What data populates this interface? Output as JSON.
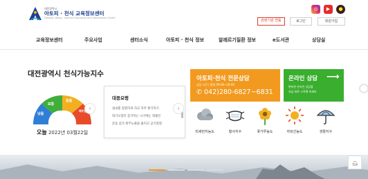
{
  "header": {
    "logo_small": "대전광역시",
    "logo_main": "아토피 · 천식 교육정보센터",
    "logo_eng": "Daejeon Atopy · Asthma Education and Information Center",
    "sns": [
      {
        "name": "instagram",
        "glyph": "◎"
      },
      {
        "name": "youtube",
        "glyph": "▶"
      },
      {
        "name": "kakao",
        "glyph": "●"
      }
    ],
    "manager_btn": "관련기관 연동",
    "login_btn": "로그인",
    "join_btn": "회원가입"
  },
  "nav": [
    "교육정보센터",
    "주요사업",
    "센터소식",
    "아토피 · 천식 정보",
    "알레르기질환 정보",
    "e도서관",
    "상담실"
  ],
  "index": {
    "title": "대전광역시 천식가능지수",
    "gauge_labels": [
      "낮음",
      "보통",
      "높음",
      "매우높음"
    ],
    "today_label": "오늘",
    "date": "2022년 03월22일"
  },
  "action": {
    "title": "대응요령",
    "lines": [
      "실내를 청결하게 하고 자주 환기하기",
      "대기오염이 증가하는 시기에는 외출은",
      "운동 삼가 외부노출을 줄이고 공기청정"
    ]
  },
  "consult": {
    "title": "아토피·천식 전문상담",
    "hours": "상담 시간 | 평일 09:00~18:00",
    "phone": "042)280-6827~6831"
  },
  "online": {
    "title": "온라인 상담",
    "arrow": "⟶",
    "lines": [
      "편리한 온라인 상담을",
      "지금 바로 시작해 보세요"
    ]
  },
  "indices": [
    {
      "label": "미세먼지농도",
      "icon": "dust-cloud"
    },
    {
      "label": "황사지수",
      "icon": "mask"
    },
    {
      "label": "꽃가루농도",
      "icon": "flower"
    },
    {
      "label": "자외선농도",
      "icon": "sun"
    },
    {
      "label": "생활지수",
      "icon": "umbrella"
    }
  ],
  "colors": {
    "accent": "#f29a1f",
    "green": "#3aae2e",
    "navy": "#1a3f8f",
    "red": "#e03a2b"
  },
  "top_btn": {
    "chevron": "︿",
    "label": "TOP"
  }
}
